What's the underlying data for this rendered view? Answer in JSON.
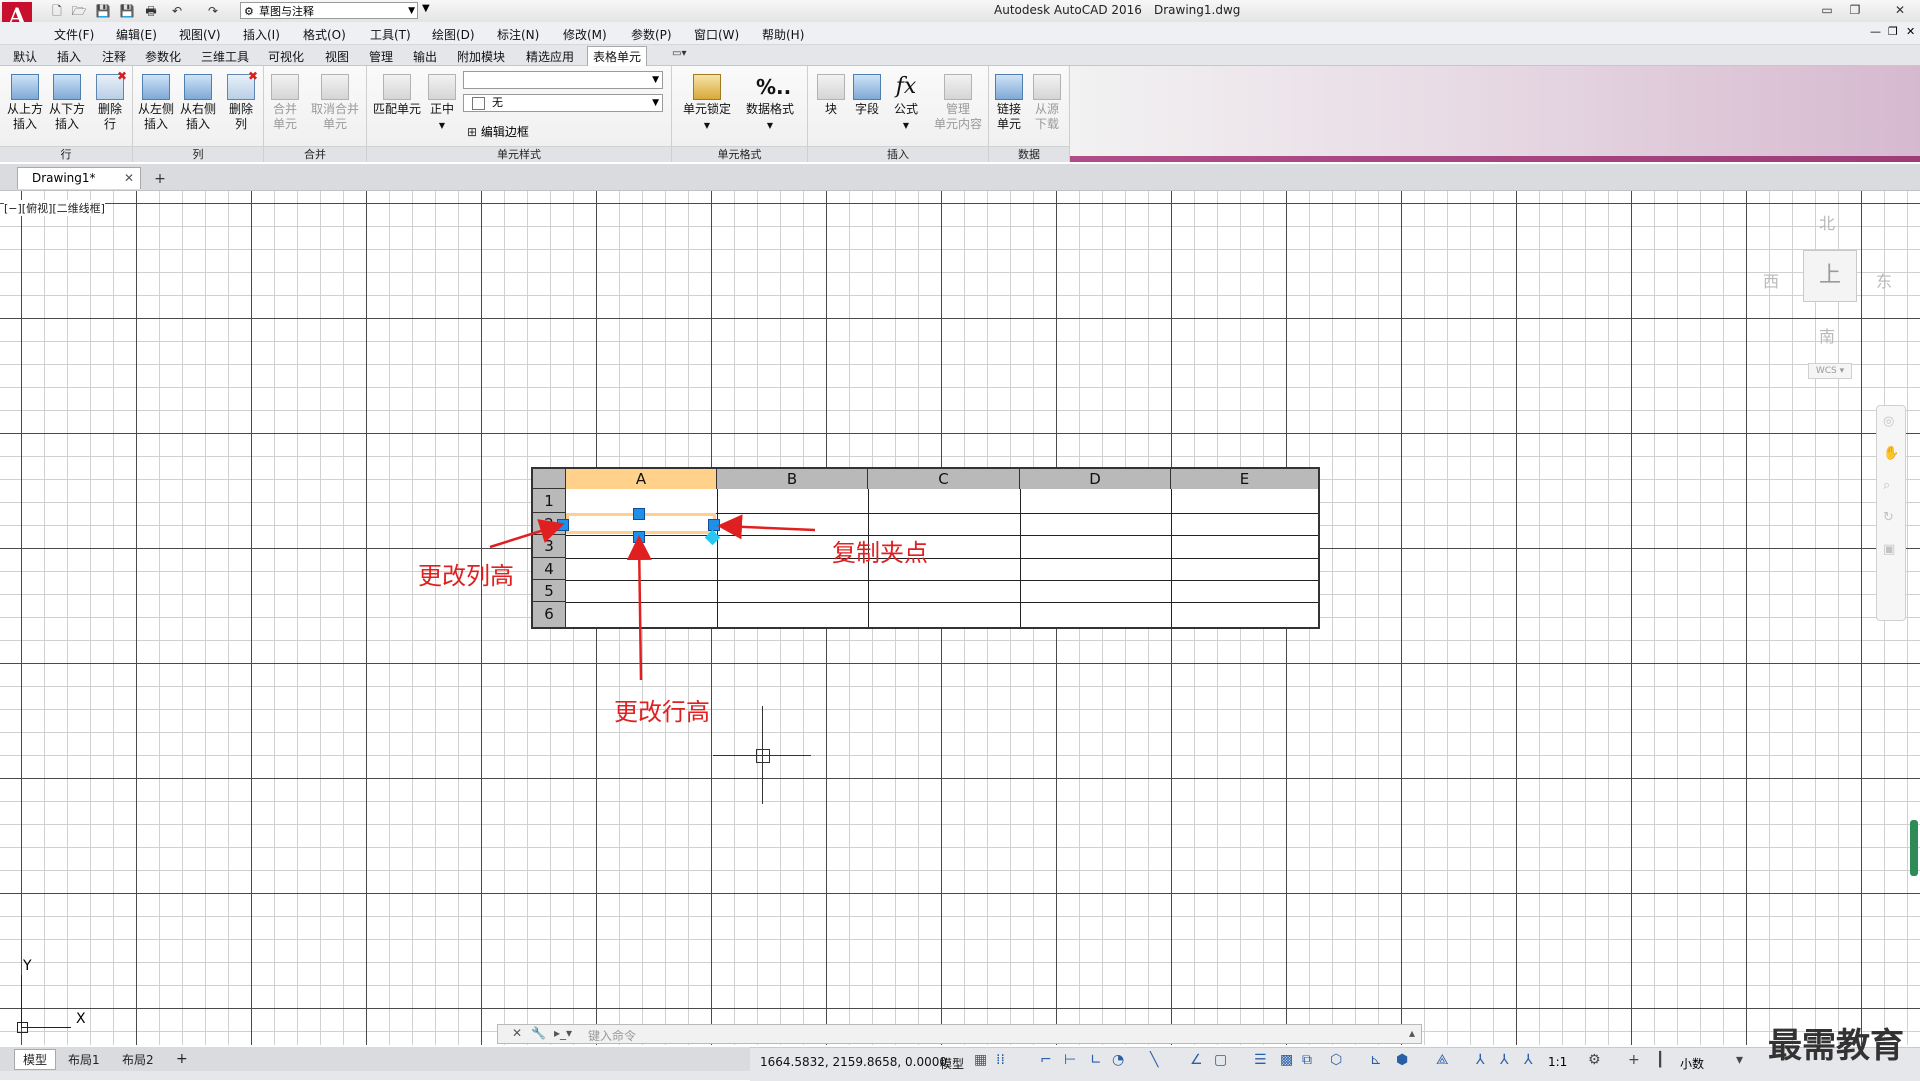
{
  "titlebar": {
    "workspace": "草图与注释",
    "app_title": "Autodesk AutoCAD 2016",
    "file_title": "Drawing1.dwg"
  },
  "menu": [
    "文件(F)",
    "编辑(E)",
    "视图(V)",
    "插入(I)",
    "格式(O)",
    "工具(T)",
    "绘图(D)",
    "标注(N)",
    "修改(M)",
    "参数(P)",
    "窗口(W)",
    "帮助(H)"
  ],
  "ribbon_tabs": [
    "默认",
    "插入",
    "注释",
    "参数化",
    "三维工具",
    "可视化",
    "视图",
    "管理",
    "输出",
    "附加模块",
    "精选应用",
    "表格单元"
  ],
  "ribbon": {
    "panels": {
      "row": "行",
      "col": "列",
      "merge": "合并",
      "cell_style": "单元样式",
      "cell_format": "单元格式",
      "insert": "插入",
      "data": "数据"
    },
    "buttons": {
      "insert_above": [
        "从上方",
        "插入"
      ],
      "insert_below": [
        "从下方",
        "插入"
      ],
      "delete_row": [
        "删除",
        "行"
      ],
      "insert_left": [
        "从左侧",
        "插入"
      ],
      "insert_right": [
        "从右侧",
        "插入"
      ],
      "delete_col": [
        "删除",
        "列"
      ],
      "merge_cells": [
        "合并",
        "单元"
      ],
      "unmerge_cells": [
        "取消合并",
        "单元"
      ],
      "match_cell": "匹配单元",
      "align_center": "正中",
      "edit_borders": "编辑边框",
      "cell_lock": "单元锁定",
      "data_format": "数据格式",
      "block": "块",
      "field": "字段",
      "formula": "公式",
      "manage_content": [
        "管理",
        "单元内容"
      ],
      "link_cell": [
        "链接",
        "单元"
      ],
      "download_source": [
        "从源",
        "下载"
      ]
    },
    "cell_style_value": "",
    "fill_value": "无"
  },
  "doc_tab": "Drawing1*",
  "viewport_label": "[−][俯视][二维线框]",
  "viewcube": {
    "north": "北",
    "south": "南",
    "east": "东",
    "west": "西",
    "wcs": "WCS"
  },
  "table": {
    "columns": [
      "A",
      "B",
      "C",
      "D",
      "E"
    ],
    "rows": [
      "1",
      "2",
      "3",
      "4",
      "5",
      "6"
    ]
  },
  "annotations": {
    "column_height": "更改列高",
    "row_height": "更改行高",
    "copy_grip": "复制夹点"
  },
  "ucs": {
    "x": "X",
    "y": "Y"
  },
  "command": {
    "placeholder": "键入命令"
  },
  "layout_tabs": [
    "模型",
    "布局1",
    "布局2"
  ],
  "status": {
    "coords": "1664.5832, 2159.8658, 0.0000",
    "model": "模型",
    "scale": "1:1",
    "units": "小数"
  },
  "watermark": "最需教育"
}
